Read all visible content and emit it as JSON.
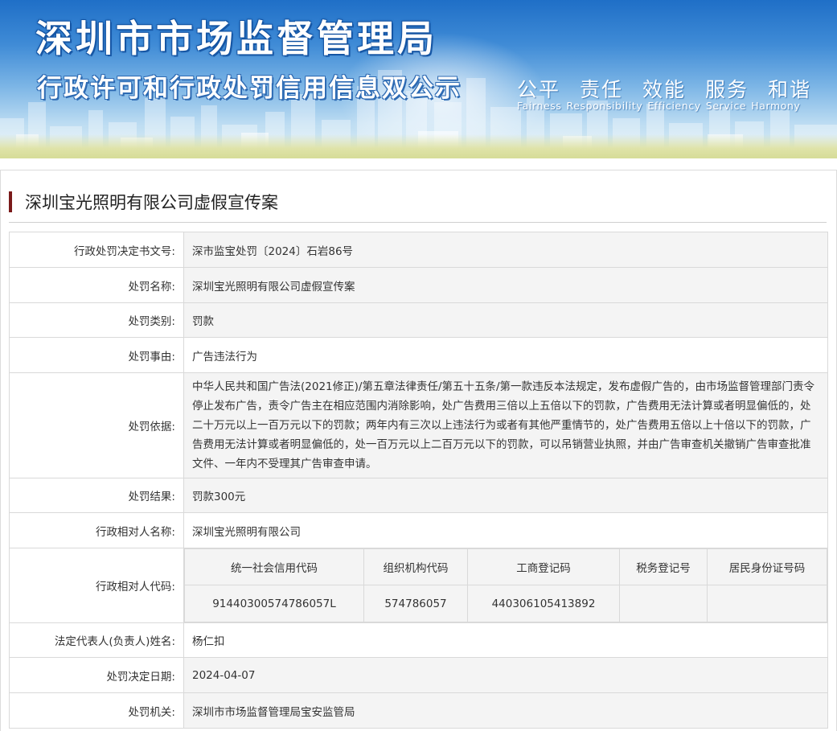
{
  "banner": {
    "title": "深圳市市场监督管理局",
    "subtitle": "行政许可和行政处罚信用信息双公示",
    "slogan_cn": [
      "公平",
      "责任",
      "效能",
      "服务",
      "和谐"
    ],
    "slogan_en": [
      "Fairness",
      "Responsibility",
      "Efficiency",
      "Service",
      "Harmony"
    ]
  },
  "case_title": "深圳宝光照明有限公司虚假宣传案",
  "fields": {
    "doc_no": {
      "label": "行政处罚决定书文号:",
      "value": "深市监宝处罚〔2024〕石岩86号"
    },
    "name": {
      "label": "处罚名称:",
      "value": "深圳宝光照明有限公司虚假宣传案"
    },
    "category": {
      "label": "处罚类别:",
      "value": "罚款"
    },
    "cause": {
      "label": "处罚事由:",
      "value": "广告违法行为"
    },
    "basis": {
      "label": "处罚依据:",
      "value": "中华人民共和国广告法(2021修正)/第五章法律责任/第五十五条/第一款违反本法规定，发布虚假广告的，由市场监督管理部门责令停止发布广告，责令广告主在相应范围内消除影响，处广告费用三倍以上五倍以下的罚款，广告费用无法计算或者明显偏低的，处二十万元以上一百万元以下的罚款；两年内有三次以上违法行为或者有其他严重情节的，处广告费用五倍以上十倍以下的罚款，广告费用无法计算或者明显偏低的，处一百万元以上二百万元以下的罚款，可以吊销营业执照，并由广告审查机关撤销广告审查批准文件、一年内不受理其广告审查申请。"
    },
    "result": {
      "label": "处罚结果:",
      "value": "罚款300元"
    },
    "party_name": {
      "label": "行政相对人名称:",
      "value": "深圳宝光照明有限公司"
    },
    "party_code": {
      "label": "行政相对人代码:",
      "headers": [
        "统一社会信用代码",
        "组织机构代码",
        "工商登记码",
        "税务登记号",
        "居民身份证号码"
      ],
      "values": [
        "91440300574786057L",
        "574786057",
        "440306105413892",
        "",
        ""
      ]
    },
    "legal_rep": {
      "label": "法定代表人(负责人)姓名:",
      "value": "杨仁扣"
    },
    "decision_date": {
      "label": "处罚决定日期:",
      "value": "2024-04-07"
    },
    "authority": {
      "label": "处罚机关:",
      "value": "深圳市市场监督管理局宝安监管局"
    }
  }
}
